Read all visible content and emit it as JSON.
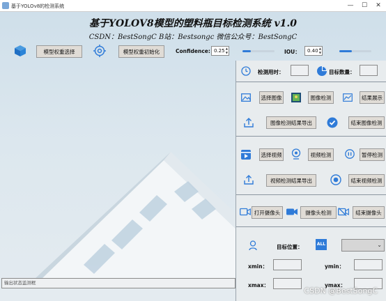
{
  "window": {
    "title": "基于YOLOv8的检测系统",
    "minimize": "—",
    "maximize": "☐",
    "close": "✕"
  },
  "header": {
    "title": "基于YOLOV8模型的塑料瓶目标检测系统 v1.0",
    "subtitle": "CSDN：BestSongC    B站：Bestsongc    微信公众号：BestSongC"
  },
  "toolbar": {
    "model_select": "模型权重选择",
    "model_init": "模型权重初始化",
    "confidence_label": "Confidence:",
    "confidence_value": "0.25",
    "confidence_level": 0.25,
    "iou_label": "IOU：",
    "iou_value": "0.40",
    "iou_level": 0.4
  },
  "panel": {
    "time_label": "检测用时：",
    "count_label": "目标数量：",
    "select_image": "选择图像",
    "image_detect": "图像检测",
    "result_show": "结果展示",
    "image_export": "图像检测结果导出",
    "end_image": "结束图像检测",
    "select_video": "选择视频",
    "video_detect": "视频检测",
    "pause_detect": "暂停检测",
    "video_export": "视频检测结果导出",
    "end_video": "结束视频检测",
    "open_camera": "打开摄像头",
    "camera_detect": "摄像头检测",
    "end_camera": "结束摄像头",
    "target_pos": "目标位置：",
    "all_icon_text": "ALL",
    "xmin": "xmin：",
    "ymin": "ymin：",
    "xmax": "xmax：",
    "ymax": "ymax："
  },
  "status": {
    "placeholder": "输出状态监测框"
  },
  "watermark": "CSDN @BestSongC",
  "colors": {
    "accent": "#2f7bd8",
    "panel": "#e8ecee"
  }
}
